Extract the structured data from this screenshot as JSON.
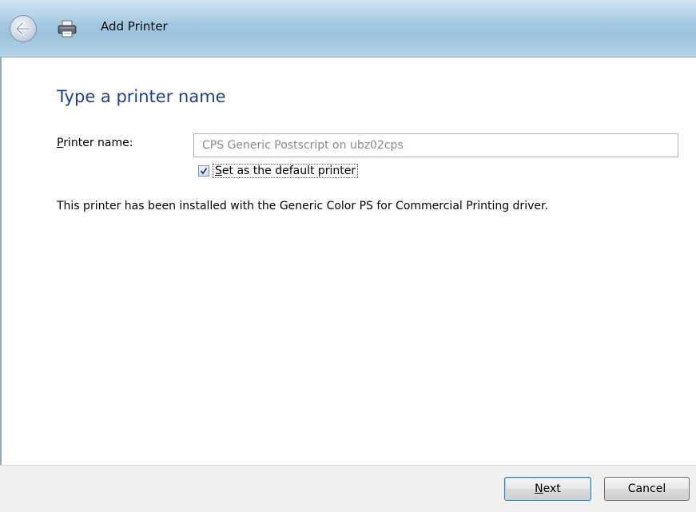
{
  "window": {
    "title": "Add Printer"
  },
  "titlebar": {
    "back_icon": "back-arrow-icon",
    "app_icon": "printer-icon"
  },
  "main": {
    "heading": "Type a printer name",
    "printer_name_label_key": "P",
    "printer_name_label_rest": "rinter name:",
    "printer_name_value": "CPS Generic Postscript on ubz02cps",
    "default_checkbox_checked": true,
    "default_label_key": "S",
    "default_label_rest": "et as the default printer",
    "info_text": "This printer has been installed with the Generic Color PS for Commercial Printing driver."
  },
  "footer": {
    "next_label_key": "N",
    "next_label_rest": "ext",
    "cancel_label": "Cancel"
  },
  "colors": {
    "heading": "#1e3e91",
    "titlebar": "#a8cbe3",
    "footer": "#f0f0f0"
  }
}
